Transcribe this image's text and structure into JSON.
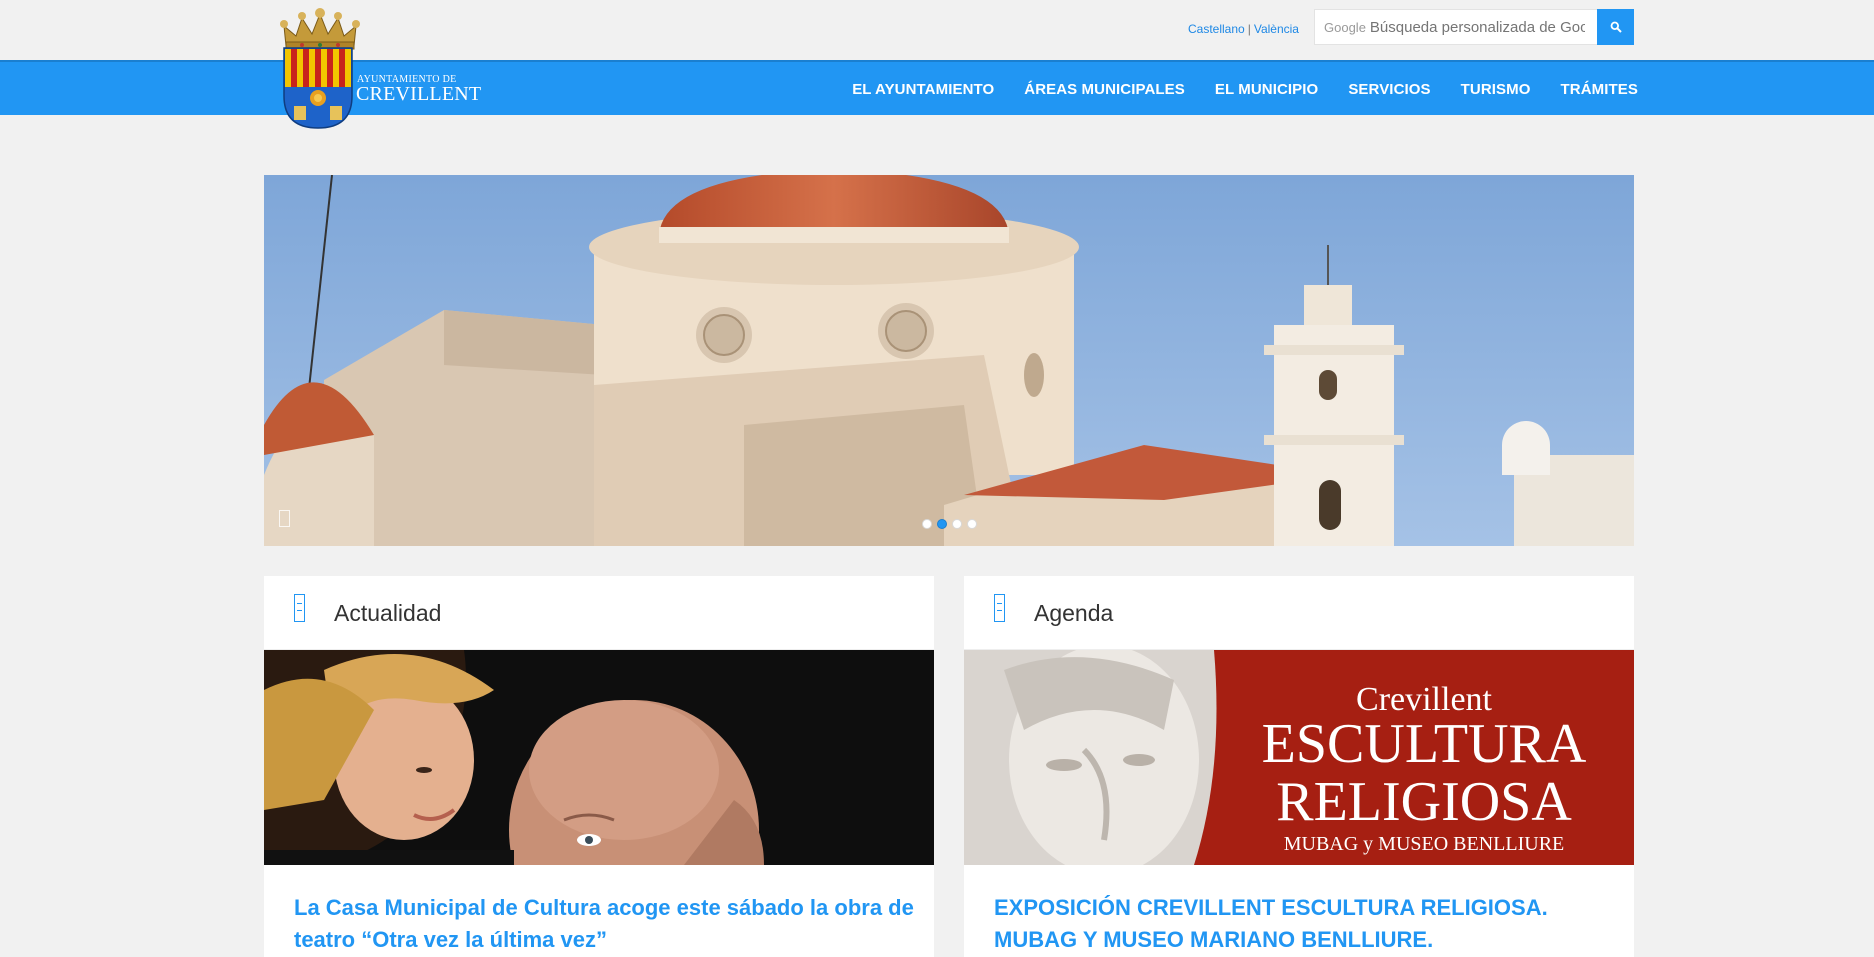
{
  "header": {
    "lang_castellano": "Castellano",
    "lang_separator": "|",
    "lang_valencia": "València",
    "search_label": "Google",
    "search_placeholder": "Búsqueda personalizada de Goog"
  },
  "logo": {
    "line1": "AYUNTAMIENTO DE",
    "line2": "CREVILLENT"
  },
  "nav": {
    "items": [
      "EL AYUNTAMIENTO",
      "ÁREAS MUNICIPALES",
      "EL MUNICIPIO",
      "SERVICIOS",
      "TURISMO",
      "TRÁMITES"
    ]
  },
  "slider": {
    "dots_count": 4,
    "active_dot": 2
  },
  "sections": {
    "news": {
      "title": "Actualidad",
      "headline": "La Casa Municipal de Cultura acoge este sábado la obra de teatro “Otra vez la última vez”"
    },
    "agenda": {
      "title": "Agenda",
      "headline": "EXPOSICIÓN CREVILLENT ESCULTURA RELIGIOSA. MUBAG Y MUSEO MARIANO BENLLIURE.",
      "poster_line1": "Crevillent",
      "poster_line2": "ESCULTURA",
      "poster_line3": "RELIGIOSA",
      "poster_line4": "MUBAG y MUSEO BENLLIURE"
    }
  },
  "colors": {
    "accent": "#2196f3",
    "background": "#f1f1f1",
    "poster_red": "#a61f12"
  }
}
